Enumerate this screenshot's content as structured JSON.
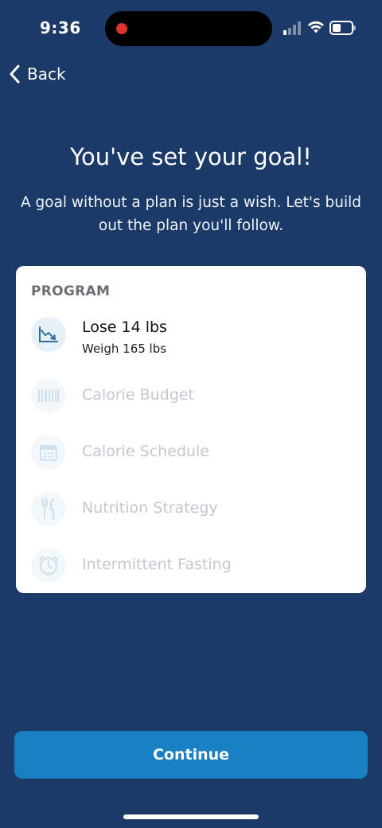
{
  "status_bar": {
    "time": "9:36",
    "icons": [
      "cellular-signal-icon",
      "wifi-icon",
      "battery-icon"
    ],
    "recording_indicator_color": "#e03131"
  },
  "nav": {
    "back_label": "Back"
  },
  "header": {
    "title": "You've set your goal!",
    "subtitle": "A goal without a plan is just a wish. Let's build out the plan you'll follow."
  },
  "program": {
    "heading": "PROGRAM",
    "items": [
      {
        "label": "Lose 14 lbs",
        "sub": "Weigh 165 lbs",
        "icon": "weight-trend-chart-icon",
        "state": "active"
      },
      {
        "label": "Calorie Budget",
        "icon": "barcode-icon",
        "state": "inactive"
      },
      {
        "label": "Calorie Schedule",
        "icon": "calendar-icon",
        "state": "inactive"
      },
      {
        "label": "Nutrition Strategy",
        "icon": "fork-knife-icon",
        "state": "inactive"
      },
      {
        "label": "Intermittent Fasting",
        "icon": "alarm-clock-icon",
        "state": "inactive"
      }
    ]
  },
  "footer": {
    "continue_label": "Continue"
  },
  "colors": {
    "background": "#1b3a67",
    "card": "#ffffff",
    "accent": "#1a80c4",
    "icon_active": "#2e6f9e",
    "icon_inactive": "#cfe1ee",
    "text_inactive": "#c4c8cd"
  }
}
